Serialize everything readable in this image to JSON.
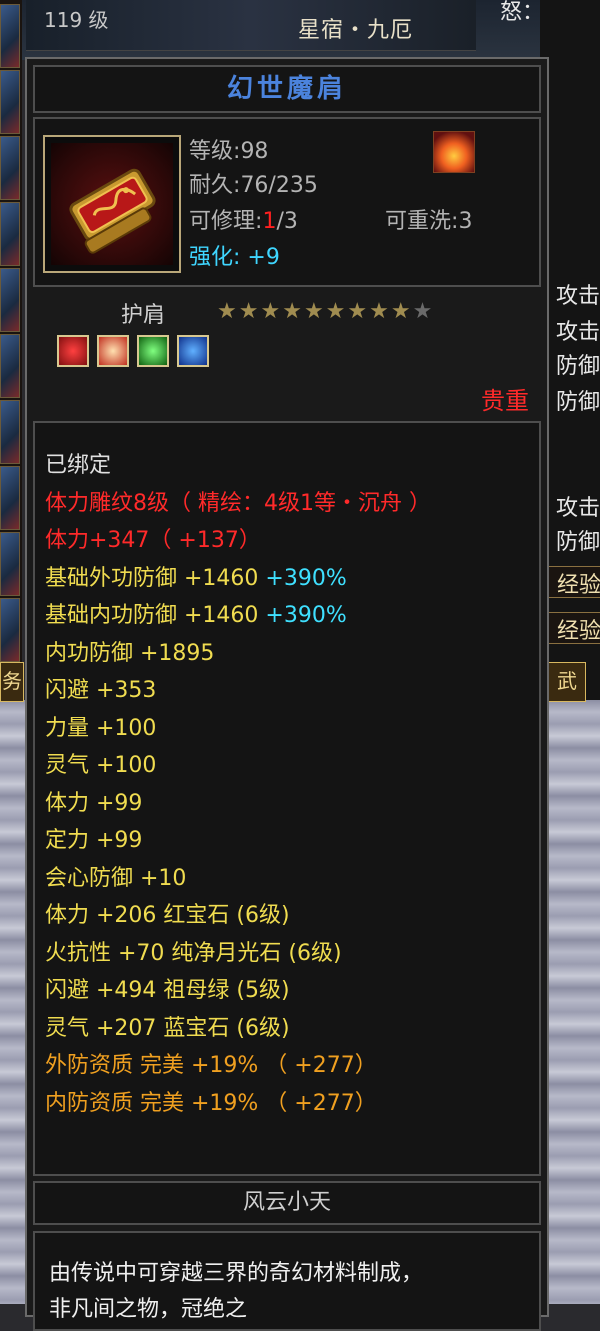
{
  "background": {
    "top_level": "119 级",
    "top_name": "星宿・九厄",
    "right_labels": [
      "攻击",
      "攻击",
      "防御",
      "防御",
      "攻击",
      "防御"
    ],
    "right_panels": [
      "经验",
      "经验"
    ],
    "top_right": "怒：",
    "left_tab": "务",
    "right_tab": "武"
  },
  "item": {
    "name": "幻世魔肩",
    "icon": "golden-shoulder-pad-icon",
    "level_label": "等级",
    "level_value": "98",
    "durability_label": "耐久",
    "durability_value": "76/235",
    "repair_label": "可修理",
    "repair_current": "1",
    "repair_max": "/3",
    "rewash_label": "可重洗",
    "rewash_value": "3",
    "enhance_label": "强化",
    "enhance_value": "+9",
    "type": "护肩",
    "stars_filled": 9,
    "stars_total": 10,
    "gems": [
      "red-gem",
      "moon-gem",
      "emerald-gem",
      "sapphire-gem"
    ],
    "rarity": "贵重"
  },
  "stats": [
    {
      "text": "已绑定",
      "color": "white"
    },
    {
      "text": "体力雕纹8级（ 精绘：4级1等・沉舟 ）",
      "color": "red"
    },
    {
      "text": "体力+347（ +137）",
      "color": "red"
    },
    {
      "text": "基础外功防御 +1460",
      "extra": " +390%",
      "color": "yellow"
    },
    {
      "text": "基础内功防御 +1460",
      "extra": " +390%",
      "color": "yellow"
    },
    {
      "text": "内功防御 +1895",
      "color": "yellow"
    },
    {
      "text": "闪避 +353",
      "color": "yellow"
    },
    {
      "text": "力量 +100",
      "color": "yellow"
    },
    {
      "text": "灵气 +100",
      "color": "yellow"
    },
    {
      "text": "体力 +99",
      "color": "yellow"
    },
    {
      "text": "定力 +99",
      "color": "yellow"
    },
    {
      "text": "会心防御 +10",
      "color": "yellow"
    },
    {
      "text": "体力 +206 红宝石 (6级)",
      "color": "yellow"
    },
    {
      "text": "火抗性 +70 纯净月光石 (6级)",
      "color": "yellow"
    },
    {
      "text": "闪避 +494 祖母绿 (5级)",
      "color": "yellow"
    },
    {
      "text": "灵气 +207 蓝宝石 (6级)",
      "color": "yellow"
    },
    {
      "text": "外防资质   完美 +19% （ +277）",
      "color": "orange"
    },
    {
      "text": "内防资质   完美 +19% （ +277）",
      "color": "orange"
    }
  ],
  "flavor": {
    "title": "风云小天",
    "line1": "由传说中可穿越三界的奇幻材料制成，",
    "line2": "非凡间之物，冠绝之"
  },
  "colors": {
    "red": "#ff2a2a",
    "yellow": "#f0dc50",
    "orange": "#f0a020",
    "cyan": "#3fe0ff",
    "title_blue": "#4b83dd"
  }
}
